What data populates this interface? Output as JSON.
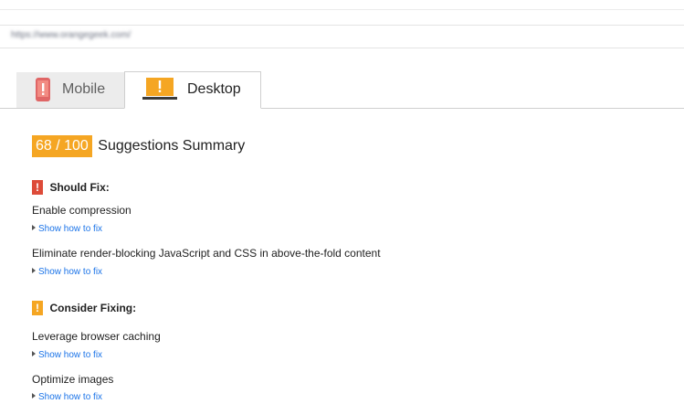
{
  "url_bar": {
    "value": "https://www.orangegeek.com/"
  },
  "tabs": [
    {
      "label": "Mobile",
      "icon": "phone-warning-icon",
      "active": false
    },
    {
      "label": "Desktop",
      "icon": "laptop-warning-icon",
      "active": true
    }
  ],
  "summary": {
    "score": "68 / 100",
    "title": "Suggestions Summary",
    "score_color": "#f5a623"
  },
  "should_fix": {
    "badge": "!",
    "title": "Should Fix:",
    "color": "#dd4b39",
    "items": [
      {
        "title": "Enable compression",
        "link": "Show how to fix"
      },
      {
        "title": "Eliminate render-blocking JavaScript and CSS in above-the-fold content",
        "link": "Show how to fix"
      }
    ]
  },
  "consider_fixing": {
    "badge": "!",
    "title": "Consider Fixing:",
    "color": "#f5a623",
    "items": [
      {
        "title": "Leverage browser caching",
        "link": "Show how to fix"
      },
      {
        "title": "Optimize images",
        "link": "Show how to fix"
      }
    ]
  }
}
